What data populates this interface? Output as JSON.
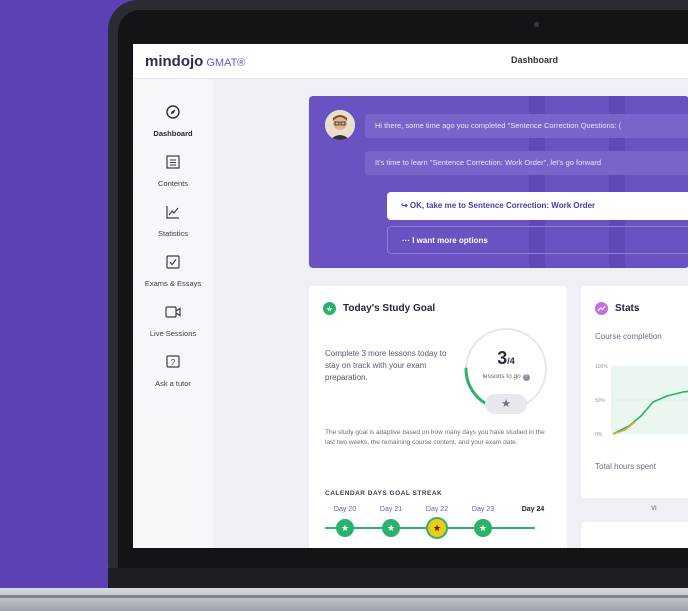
{
  "app": {
    "logo": "mindojo",
    "product": "GMAT®",
    "page_title": "Dashboard"
  },
  "sidebar": {
    "items": [
      {
        "label": "Dashboard",
        "icon": "compass-icon"
      },
      {
        "label": "Contents",
        "icon": "list-icon"
      },
      {
        "label": "Statistics",
        "icon": "chart-icon"
      },
      {
        "label": "Exams & Essays",
        "icon": "checkbox-icon"
      },
      {
        "label": "Live Sessions",
        "icon": "video-icon"
      },
      {
        "label": "Ask a tutor",
        "icon": "question-icon"
      }
    ]
  },
  "chat": {
    "message1": "Hi there, some time ago you completed \"Sentence Correction Questions: (",
    "message2": "It's time to learn \"Sentence Correction: Work Order\", let's go forward",
    "option_primary": "↪ OK, take me to Sentence Correction: Work Order",
    "option_secondary": "··· I want more options"
  },
  "study_goal": {
    "title": "Today's Study Goal",
    "text": "Complete 3 more lessons today to stay on track with your exam preparation.",
    "count": "3",
    "total": "/4",
    "subtitle": "lessons to go",
    "progress": 0.25,
    "note": "The study goal is adaptive based on how many days you have studied in the last two weeks, the remaining course content, and your exam date.",
    "streak_title": "CALENDAR DAYS GOAL STREAK",
    "days": [
      "Day 20",
      "Day 21",
      "Day 22",
      "Day 23",
      "Day 24"
    ]
  },
  "stats": {
    "title": "Stats",
    "course_completion": "Course completion",
    "axis": [
      "100%",
      "50%",
      "0%"
    ],
    "hours": "Total hours spent",
    "view": "VI"
  },
  "colors": {
    "brand_purple": "#5b41b5",
    "panel_purple": "#6a52c2",
    "green": "#29b36a",
    "gold": "#f2c81a"
  }
}
